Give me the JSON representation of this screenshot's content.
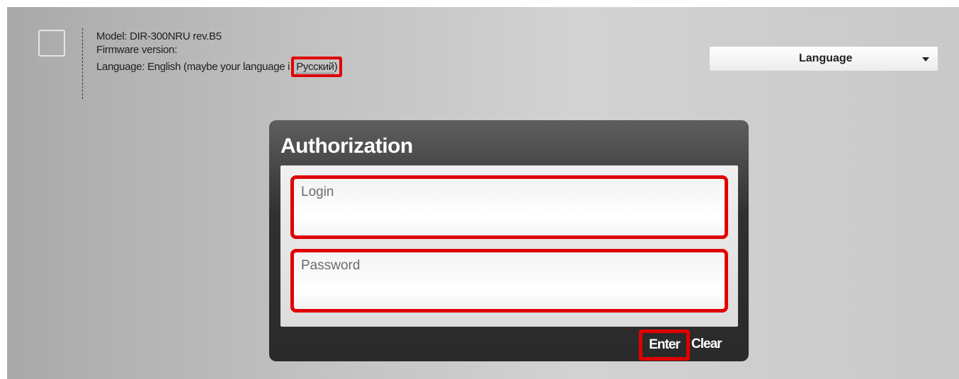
{
  "device_info": {
    "model": "Model: DIR-300NRU rev.B5",
    "firmware": "Firmware version:",
    "language_prefix": "Language: English (maybe your language i",
    "language_link": "Русский",
    "language_suffix": ")"
  },
  "language_select": {
    "label": "Language"
  },
  "auth": {
    "title": "Authorization",
    "login_placeholder": "Login",
    "password_placeholder": "Password",
    "enter_label": "Enter",
    "clear_label": "Clear"
  },
  "colors": {
    "highlight": "#e00000",
    "panel_dark": "#2a2a2a",
    "background_gray": "#c4c4c4"
  }
}
